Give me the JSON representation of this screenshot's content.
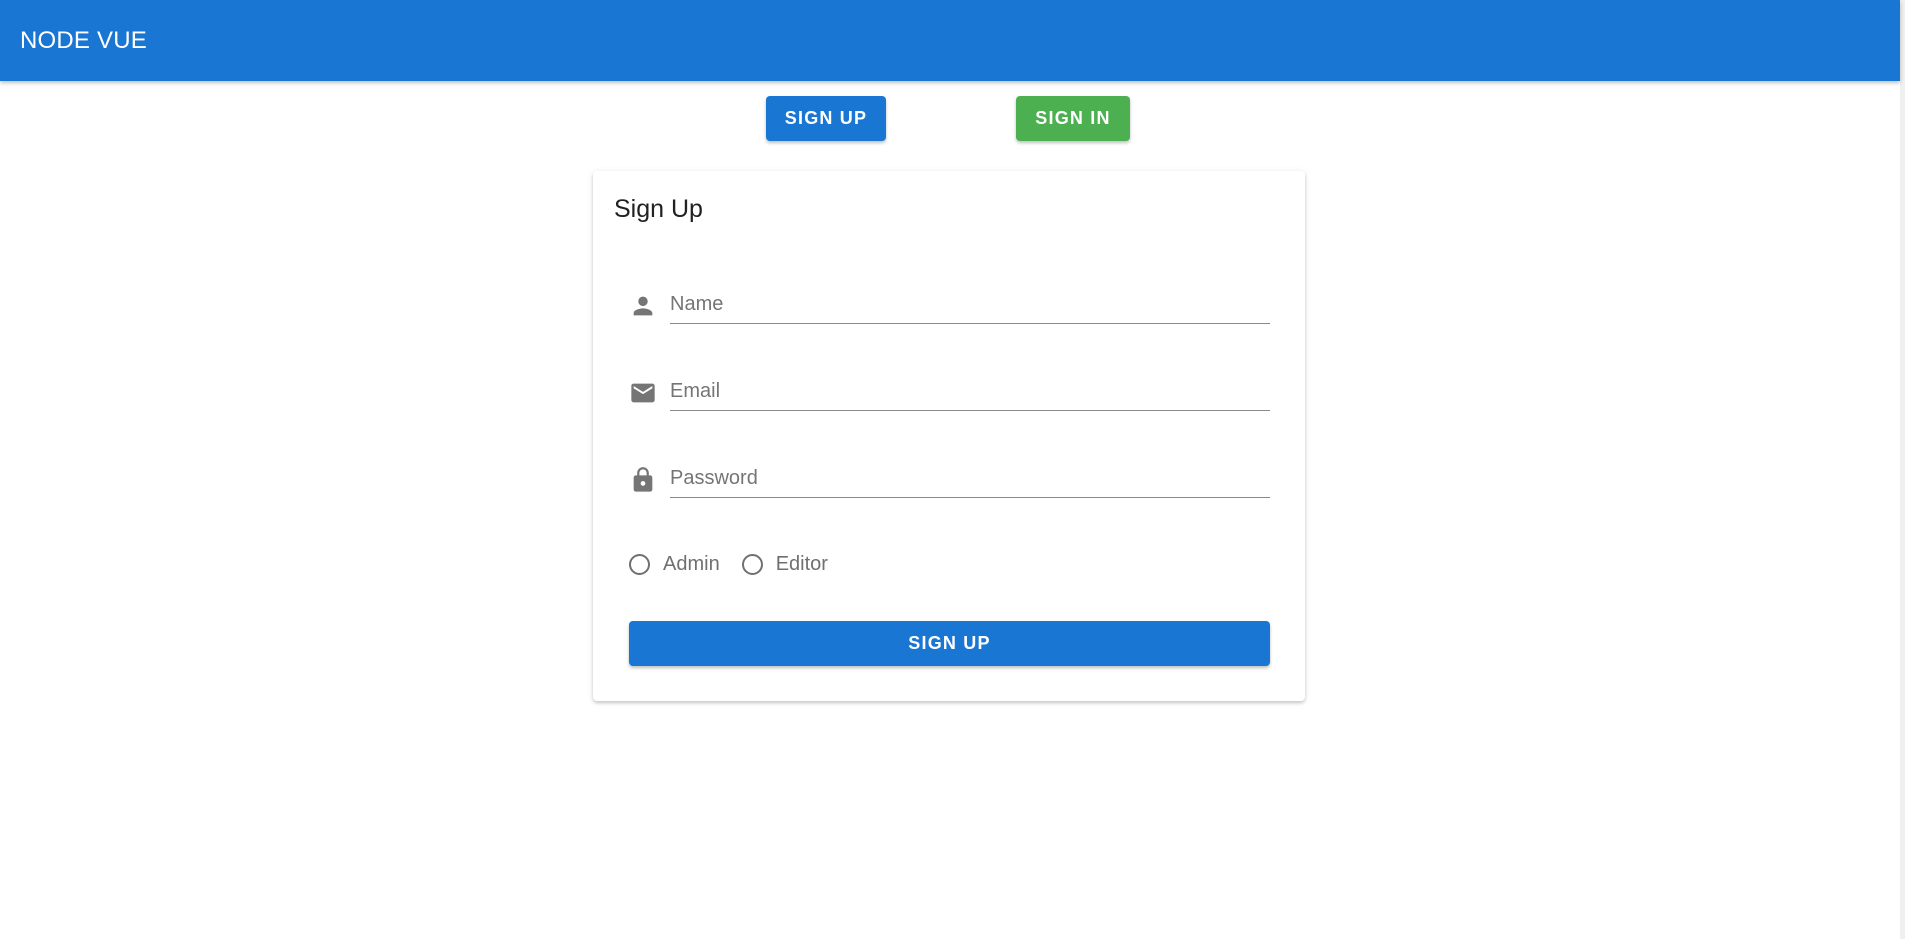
{
  "app": {
    "title": "NODE VUE"
  },
  "colors": {
    "primary": "#1976d2",
    "success": "#4caf50",
    "icon": "#757575"
  },
  "nav": {
    "signup_label": "SIGN UP",
    "signin_label": "SIGN IN"
  },
  "form": {
    "title": "Sign Up",
    "fields": {
      "name": {
        "icon": "person-icon",
        "placeholder": "Name",
        "value": ""
      },
      "email": {
        "icon": "email-icon",
        "placeholder": "Email",
        "value": ""
      },
      "password": {
        "icon": "lock-icon",
        "placeholder": "Password",
        "value": ""
      }
    },
    "roles": [
      {
        "label": "Admin",
        "selected": false
      },
      {
        "label": "Editor",
        "selected": false
      }
    ],
    "submit_label": "SIGN UP"
  }
}
